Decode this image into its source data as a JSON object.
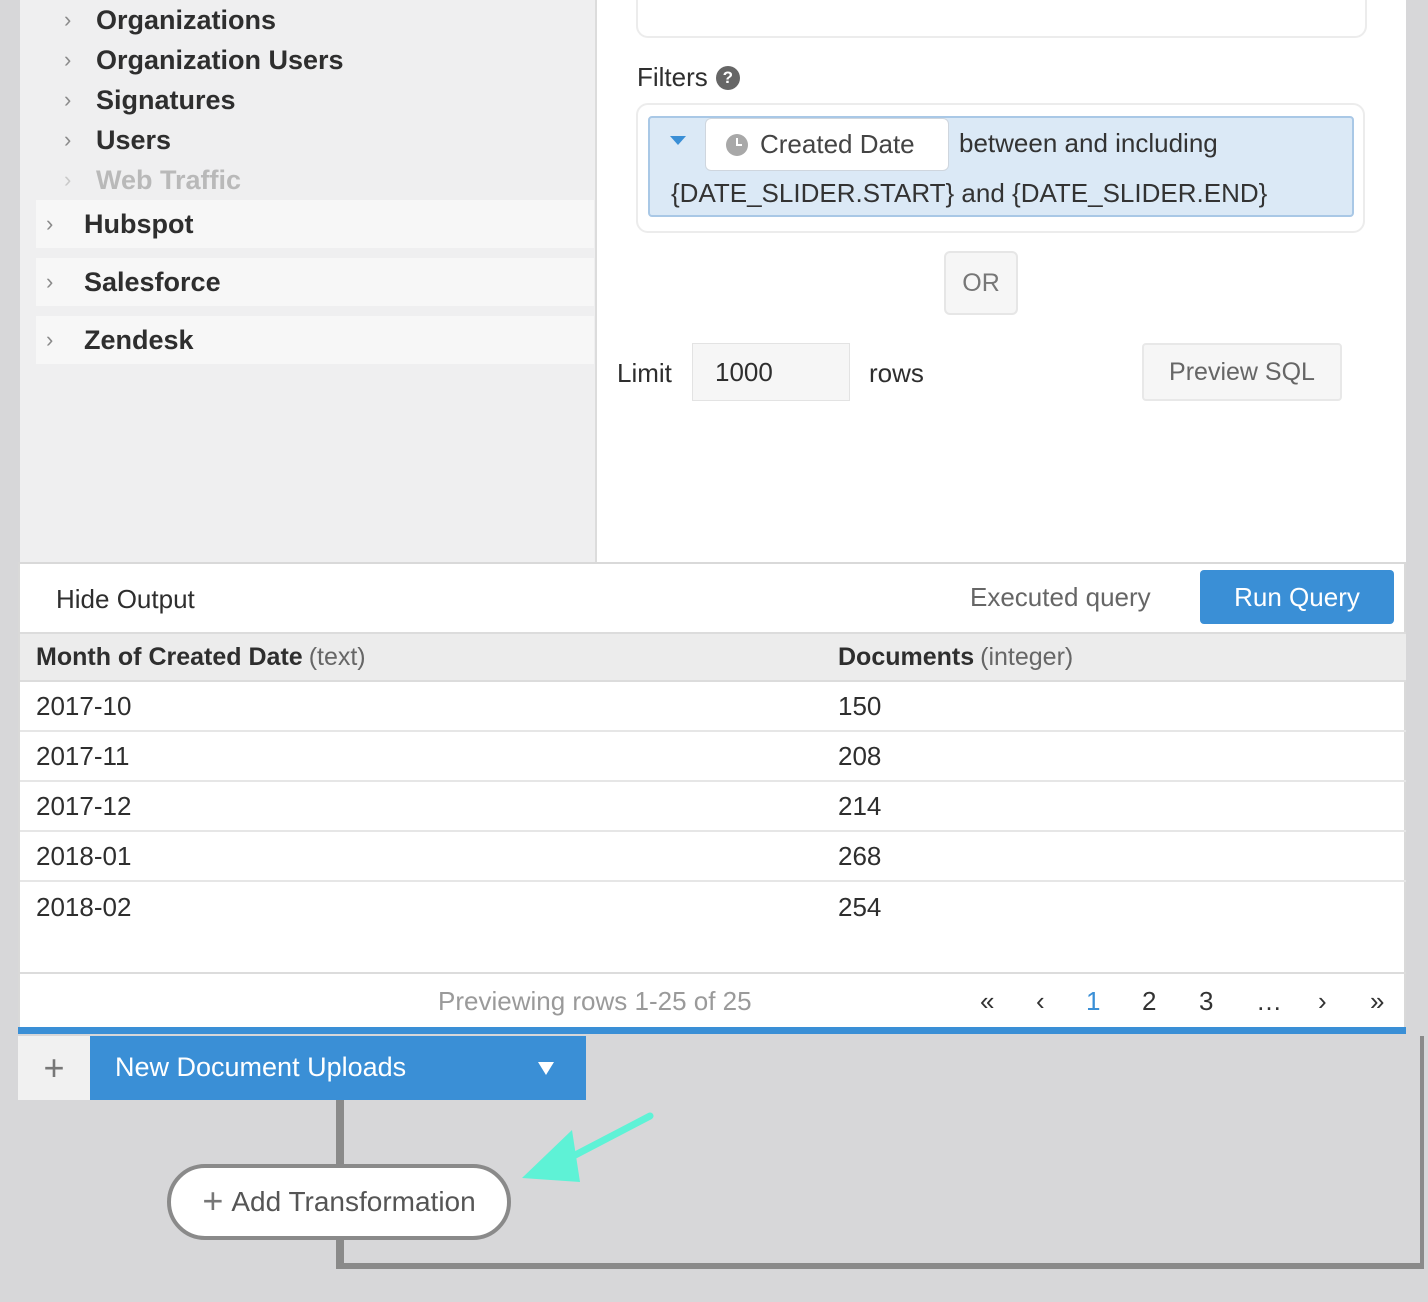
{
  "sidebar": {
    "sub_items": [
      {
        "label": "Organizations"
      },
      {
        "label": "Organization Users"
      },
      {
        "label": "Signatures"
      },
      {
        "label": "Users"
      },
      {
        "label": "Web Traffic"
      }
    ],
    "top_items": [
      {
        "label": "Hubspot"
      },
      {
        "label": "Salesforce"
      },
      {
        "label": "Zendesk"
      }
    ]
  },
  "builder": {
    "filters_label": "Filters",
    "help_glyph": "?",
    "filter": {
      "field": "Created Date",
      "operator": "between and including",
      "value": "{DATE_SLIDER.START} and {DATE_SLIDER.END}"
    },
    "or_label": "OR",
    "limit_label": "Limit",
    "limit_value": "1000",
    "rows_label": "rows",
    "preview_sql_label": "Preview SQL"
  },
  "output": {
    "hide_output_label": "Hide Output",
    "executed_label": "Executed query",
    "run_query_label": "Run Query",
    "columns": [
      {
        "name": "Month of Created Date",
        "type": "(text)"
      },
      {
        "name": "Documents",
        "type": "(integer)"
      }
    ],
    "rows": [
      [
        "2017-10",
        "150"
      ],
      [
        "2017-11",
        "208"
      ],
      [
        "2017-12",
        "214"
      ],
      [
        "2018-01",
        "268"
      ],
      [
        "2018-02",
        "254"
      ]
    ],
    "preview_range": "Previewing rows 1-25 of 25",
    "pagination": {
      "first": "«",
      "prev": "‹",
      "pages": [
        "1",
        "2",
        "3"
      ],
      "ellipsis": "…",
      "next": "›",
      "last": "»"
    }
  },
  "datasets": {
    "add_glyph": "+",
    "current": "New Document Uploads"
  },
  "transformation": {
    "add_glyph": "+",
    "label": "Add Transformation"
  },
  "colors": {
    "accent": "#3a8fd6",
    "filter_pill": "#dbe9f6",
    "arrow": "#5ef2d6"
  },
  "icons": {
    "chevron": "chevron-right-icon",
    "help": "question-circle-icon",
    "clock": "clock-icon",
    "caret": "caret-down-icon",
    "plus": "plus-icon"
  }
}
